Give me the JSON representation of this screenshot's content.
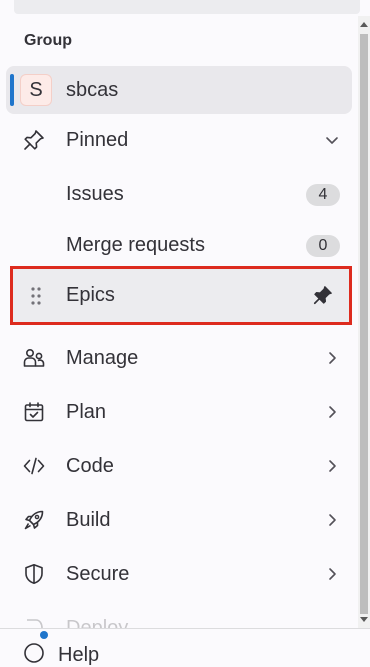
{
  "sidebar": {
    "section_title": "Group",
    "group": {
      "avatar_letter": "S",
      "name": "sbcas"
    },
    "pinned": {
      "label": "Pinned",
      "items": [
        {
          "label": "Issues",
          "count": "4"
        },
        {
          "label": "Merge requests",
          "count": "0"
        }
      ]
    },
    "epics": {
      "label": "Epics"
    },
    "nav": [
      {
        "label": "Manage",
        "icon": "users-icon"
      },
      {
        "label": "Plan",
        "icon": "calendar-icon"
      },
      {
        "label": "Code",
        "icon": "code-icon"
      },
      {
        "label": "Build",
        "icon": "rocket-icon"
      },
      {
        "label": "Secure",
        "icon": "shield-icon"
      },
      {
        "label": "Deploy",
        "icon": "deploy-icon"
      }
    ]
  },
  "footer": {
    "help_label": "Help"
  },
  "colors": {
    "accent": "#1f75cb",
    "highlight_outline": "#dd2b1e",
    "active_background": "#e9e8ec"
  }
}
